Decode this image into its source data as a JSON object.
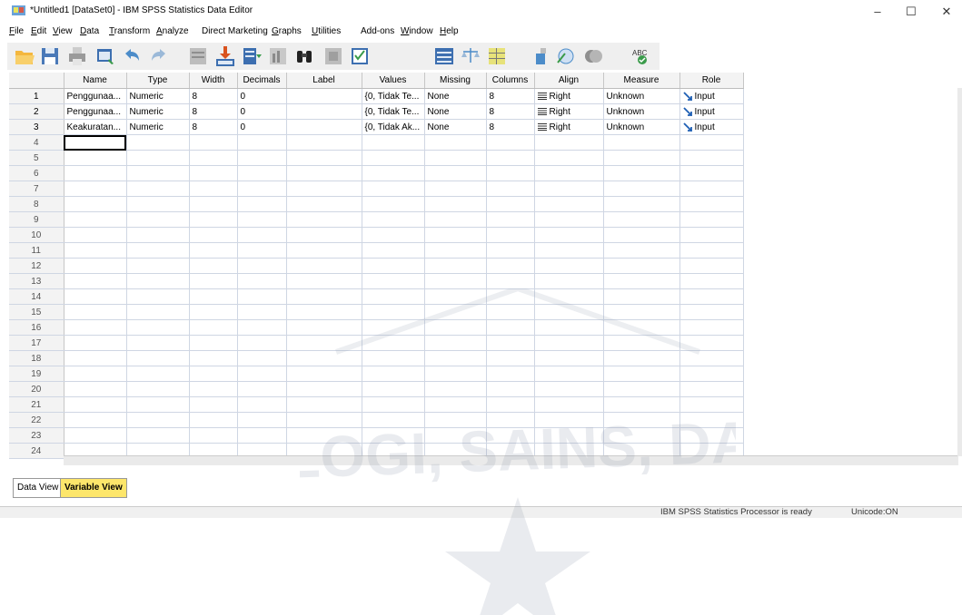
{
  "window": {
    "title": "*Untitled1 [DataSet0] - IBM SPSS Statistics Data Editor",
    "minimize": "–",
    "maximize": "☐",
    "close": "✕"
  },
  "menu": [
    {
      "label": "File",
      "underline": "F",
      "rest": "ile"
    },
    {
      "label": "Edit",
      "underline": "E",
      "rest": "dit"
    },
    {
      "label": "View",
      "underline": "V",
      "rest": "iew"
    },
    {
      "label": "Data",
      "underline": "D",
      "rest": "ata"
    },
    {
      "label": "Transform",
      "underline": "T",
      "rest": "ransform"
    },
    {
      "label": "Analyze",
      "underline": "A",
      "rest": "nalyze"
    },
    {
      "label": "Direct Marketing",
      "underline": "",
      "rest": "Direct Marketing"
    },
    {
      "label": "Graphs",
      "underline": "G",
      "rest": "raphs"
    },
    {
      "label": "Utilities",
      "underline": "U",
      "rest": "tilities"
    },
    {
      "label": "Add-ons",
      "underline": "",
      "rest": "Add-ons"
    },
    {
      "label": "Window",
      "underline": "W",
      "rest": "indow"
    },
    {
      "label": "Help",
      "underline": "H",
      "rest": "elp"
    }
  ],
  "toolbar_icons": [
    "open-data-icon",
    "save-icon",
    "print-icon",
    "dialog-recall-icon",
    "undo-icon",
    "redo-icon",
    "go-to-case-icon",
    "go-to-variable-icon",
    "variables-icon",
    "run-descriptives-icon",
    "find-icon",
    "insert-cases-icon",
    "insert-variable-icon",
    "split-file-icon",
    "weight-cases-icon",
    "select-cases-icon",
    "value-labels-icon",
    "use-variable-sets-icon",
    "show-all-variables-icon",
    "spell-check-icon"
  ],
  "grid": {
    "headers": [
      "Name",
      "Type",
      "Width",
      "Decimals",
      "Label",
      "Values",
      "Missing",
      "Columns",
      "Align",
      "Measure",
      "Role"
    ],
    "rows": [
      {
        "num": "1",
        "cells": [
          "Penggunaa...",
          "Numeric",
          "8",
          "0",
          "",
          "{0, Tidak Te...",
          "None",
          "8",
          "Right",
          "Unknown",
          "Input"
        ]
      },
      {
        "num": "2",
        "cells": [
          "Penggunaa...",
          "Numeric",
          "8",
          "0",
          "",
          "{0, Tidak Te...",
          "None",
          "8",
          "Right",
          "Unknown",
          "Input"
        ]
      },
      {
        "num": "3",
        "cells": [
          "Keakuratan...",
          "Numeric",
          "8",
          "0",
          "",
          "{0, Tidak Ak...",
          "None",
          "8",
          "Right",
          "Unknown",
          "Input"
        ]
      }
    ],
    "empty_row_numbers": [
      "4",
      "5",
      "6",
      "7",
      "8",
      "9",
      "10",
      "11",
      "12",
      "13",
      "14",
      "15",
      "16",
      "17",
      "18",
      "19",
      "20",
      "21",
      "22",
      "23",
      "24"
    ]
  },
  "tabs": {
    "data_view": "Data View",
    "variable_view": "Variable View",
    "active": "variable_view"
  },
  "status": {
    "processor": "IBM SPSS Statistics Processor is ready",
    "unicode": "Unicode:ON"
  },
  "watermark_text": "OLOGI, SAINS, DAN",
  "colors": {
    "active_tab": "#fde66b",
    "grid_line": "#cfd6e3",
    "header_bg": "#f3f3f3"
  }
}
